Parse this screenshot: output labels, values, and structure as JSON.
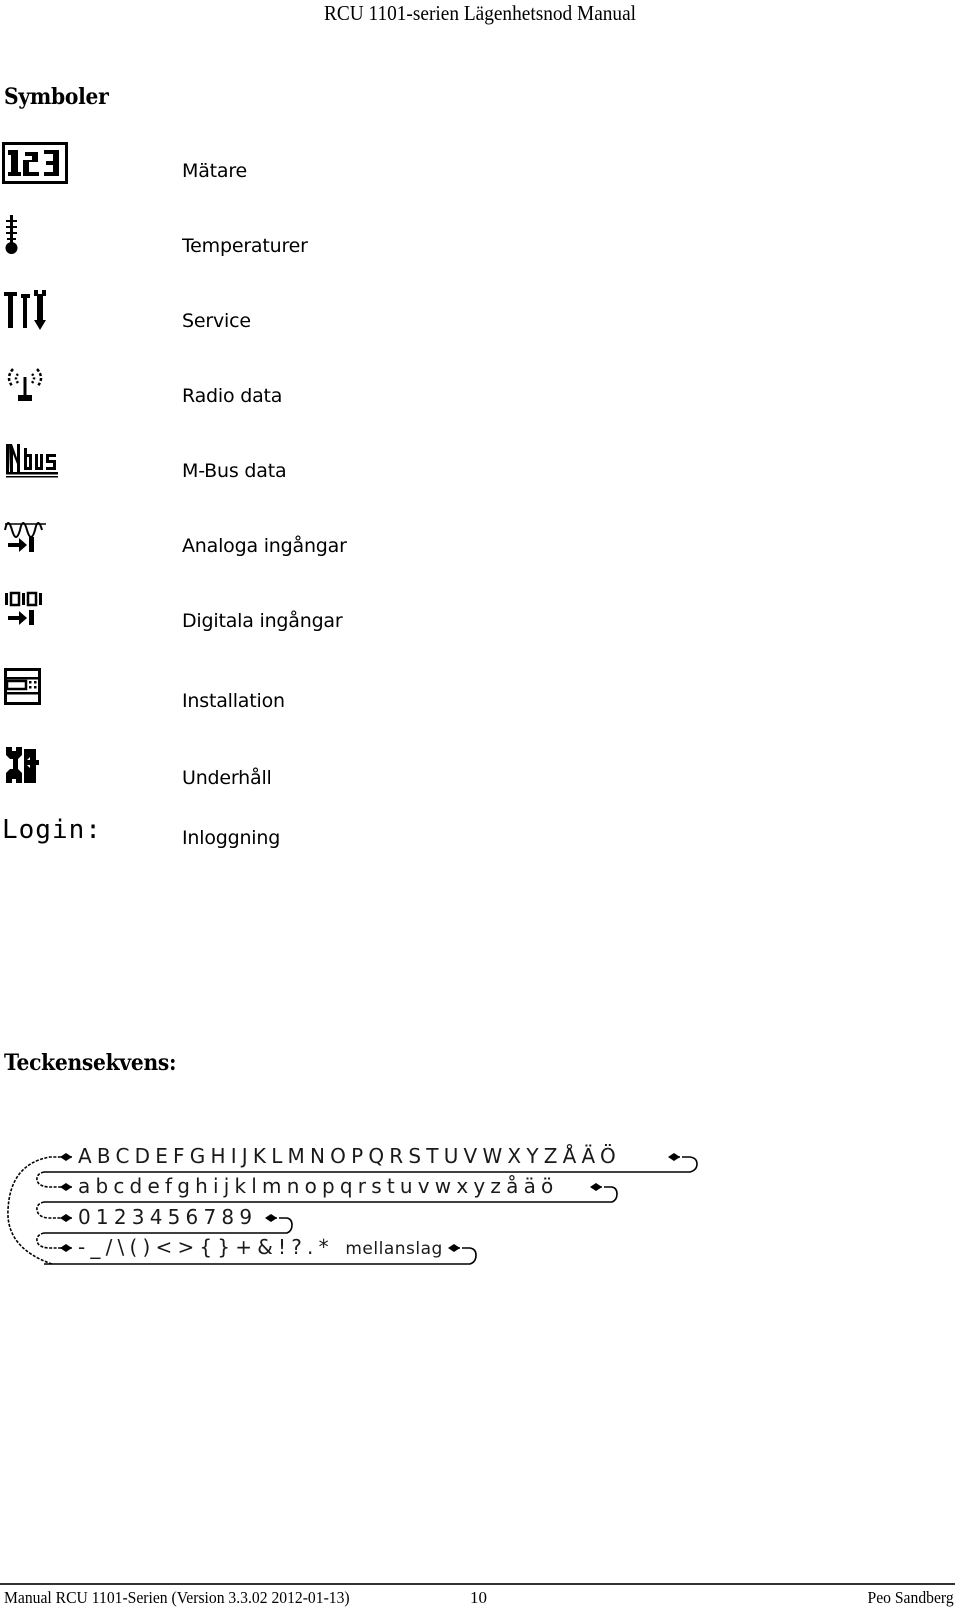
{
  "header": {
    "title": "RCU 1101-serien Lägenhetsnod Manual"
  },
  "symbols_section": {
    "heading": "Symboler",
    "items": [
      {
        "icon": "meter-123-icon",
        "label": "Mätare"
      },
      {
        "icon": "thermometer-icon",
        "label": "Temperaturer"
      },
      {
        "icon": "service-tools-icon",
        "label": "Service"
      },
      {
        "icon": "radio-antenna-icon",
        "label": "Radio data"
      },
      {
        "icon": "mbus-icon",
        "label": "M-Bus data"
      },
      {
        "icon": "analog-input-icon",
        "label": "Analoga ingångar"
      },
      {
        "icon": "digital-input-icon",
        "label": "Digitala ingångar"
      },
      {
        "icon": "installation-icon",
        "label": "Installation"
      },
      {
        "icon": "maintenance-icon",
        "label": "Underhåll"
      },
      {
        "icon": "login-icon",
        "icon_text": "Login:",
        "label": "Inloggning"
      }
    ]
  },
  "sequence_section": {
    "heading": "Teckensekvens:",
    "rows": [
      "ABCDEFGHIJKLMNOPQRSTUVWXYZÅÄÖ",
      "abcdefghijklmnopqrstuvwxyzåäö",
      "0123456789",
      "-_/\\()<>{}+&!?.*"
    ],
    "space_label": "mellanslag",
    "arrow_icon": "bidirectional-arrow-icon"
  },
  "footer": {
    "left": "Manual RCU 1101-Serien (Version 3.3.02 2012-01-13)",
    "page": "10",
    "author": "Peo Sandberg"
  }
}
